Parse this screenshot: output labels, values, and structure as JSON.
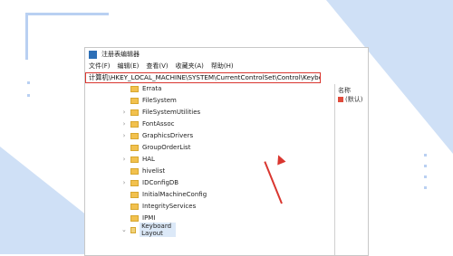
{
  "window": {
    "title": "注册表编辑器",
    "menu": [
      "文件(F)",
      "编辑(E)",
      "查看(V)",
      "收藏夹(A)",
      "帮助(H)"
    ],
    "address": "计算机\\HKEY_LOCAL_MACHINE\\SYSTEM\\CurrentControlSet\\Control\\Keyboard Layout"
  },
  "tree": {
    "items": [
      {
        "label": "Errata",
        "expander": ""
      },
      {
        "label": "FileSystem",
        "expander": ""
      },
      {
        "label": "FileSystemUtilities",
        "expander": "›"
      },
      {
        "label": "FontAssoc",
        "expander": "›"
      },
      {
        "label": "GraphicsDrivers",
        "expander": "›"
      },
      {
        "label": "GroupOrderList",
        "expander": ""
      },
      {
        "label": "HAL",
        "expander": "›"
      },
      {
        "label": "hivelist",
        "expander": ""
      },
      {
        "label": "IDConfigDB",
        "expander": "›"
      },
      {
        "label": "InitialMachineConfig",
        "expander": ""
      },
      {
        "label": "IntegrityServices",
        "expander": ""
      },
      {
        "label": "IPMI",
        "expander": ""
      },
      {
        "label": "Keyboard Layout",
        "expander": "⌄"
      }
    ]
  },
  "right": {
    "column_name": "名称",
    "value_name": "(默认)"
  },
  "colors": {
    "highlight": "#d9362f",
    "accent": "#cfe0f6"
  }
}
